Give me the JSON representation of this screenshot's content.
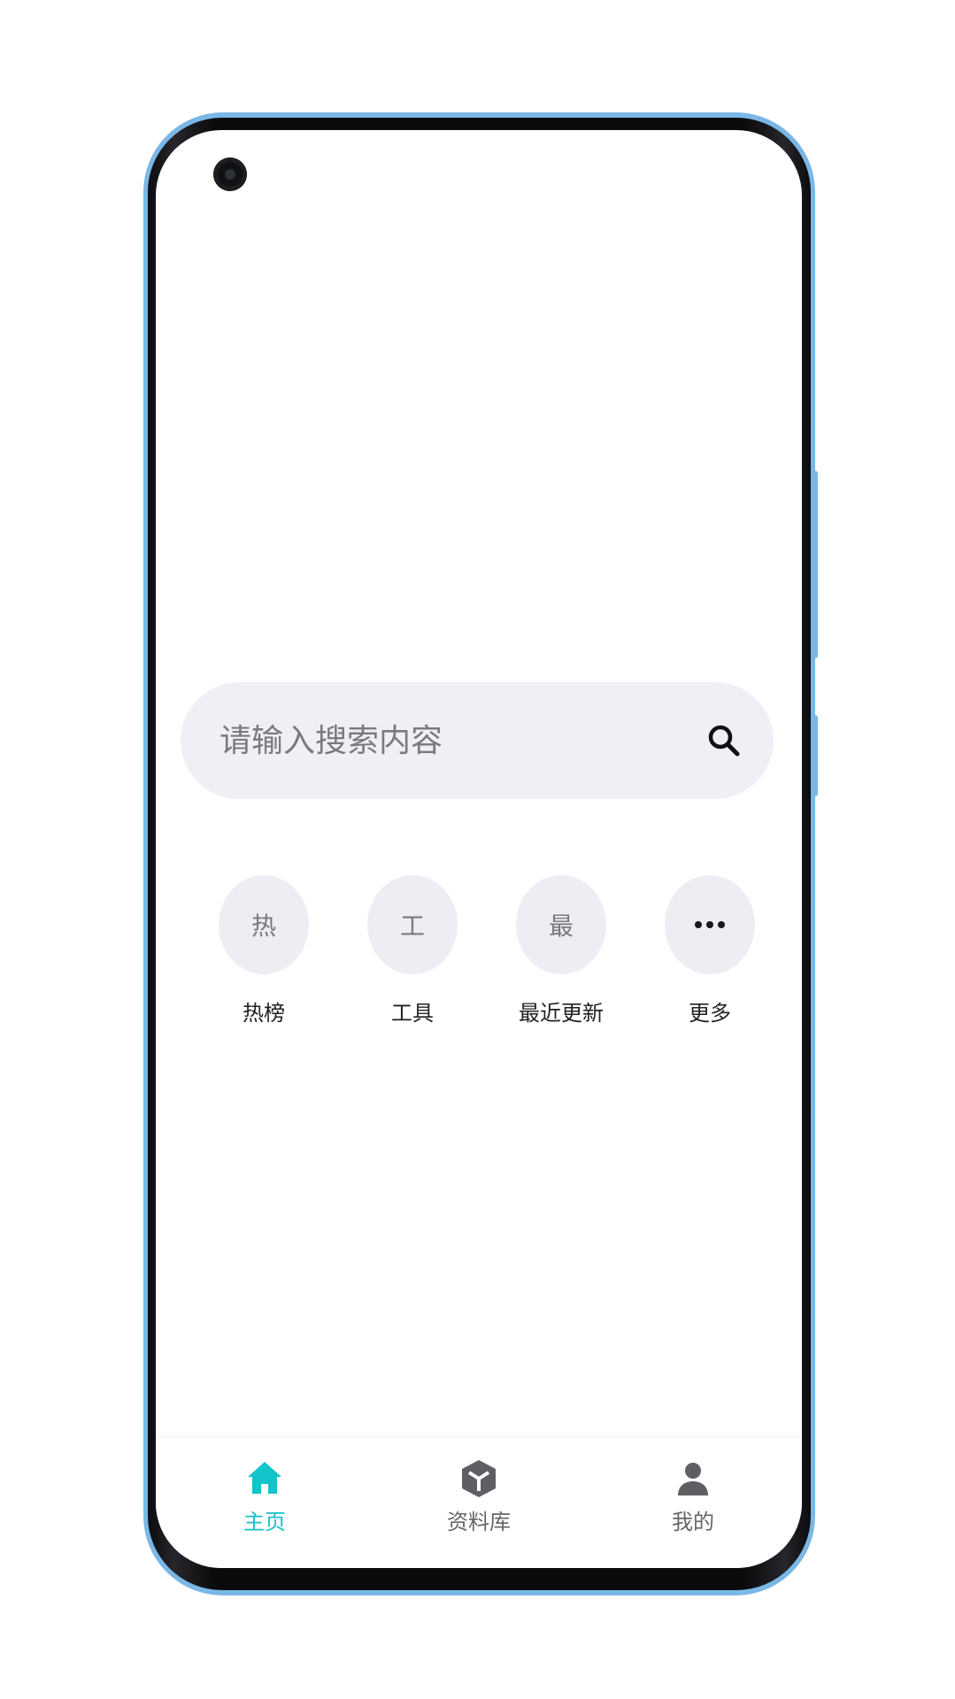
{
  "search": {
    "placeholder": "请输入搜索内容",
    "icon": "search-icon"
  },
  "quick_menu": [
    {
      "glyph": "热",
      "label": "热榜"
    },
    {
      "glyph": "工",
      "label": "工具"
    },
    {
      "glyph": "最",
      "label": "最近更新"
    },
    {
      "glyph": "",
      "label": "更多",
      "icon": "more-dots-icon"
    }
  ],
  "bottom_nav": [
    {
      "label": "主页",
      "icon": "home-icon",
      "active": true
    },
    {
      "label": "资料库",
      "icon": "box-icon",
      "active": false
    },
    {
      "label": "我的",
      "icon": "user-icon",
      "active": false
    }
  ],
  "colors": {
    "accent": "#12c3c9",
    "frame": "#7ab7e6",
    "chip_bg": "#eceef4",
    "search_bg": "#eef0f6"
  }
}
